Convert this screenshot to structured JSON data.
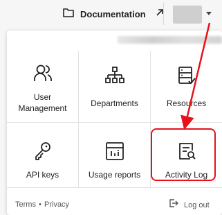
{
  "header": {
    "documentation_label": "Documentation",
    "icons": {
      "doc": "folder-icon",
      "external": "arrow-up-right-icon",
      "caret": "caret-down-icon"
    }
  },
  "menu": {
    "tiles": [
      {
        "label_line1": "User",
        "label_line2": "Management",
        "icon": "users-icon"
      },
      {
        "label": "Departments",
        "icon": "org-chart-icon"
      },
      {
        "label": "Resources",
        "icon": "server-check-icon"
      },
      {
        "label": "API keys",
        "icon": "key-icon"
      },
      {
        "label": "Usage reports",
        "icon": "report-chart-icon"
      },
      {
        "label": "Activity Log",
        "icon": "log-search-icon"
      }
    ]
  },
  "footer": {
    "terms": "Terms",
    "separator": "•",
    "privacy": "Privacy",
    "logout": "Log out"
  },
  "colors": {
    "highlight": "#e8101a",
    "background": "#f6f6f6",
    "panel": "#ffffff"
  }
}
